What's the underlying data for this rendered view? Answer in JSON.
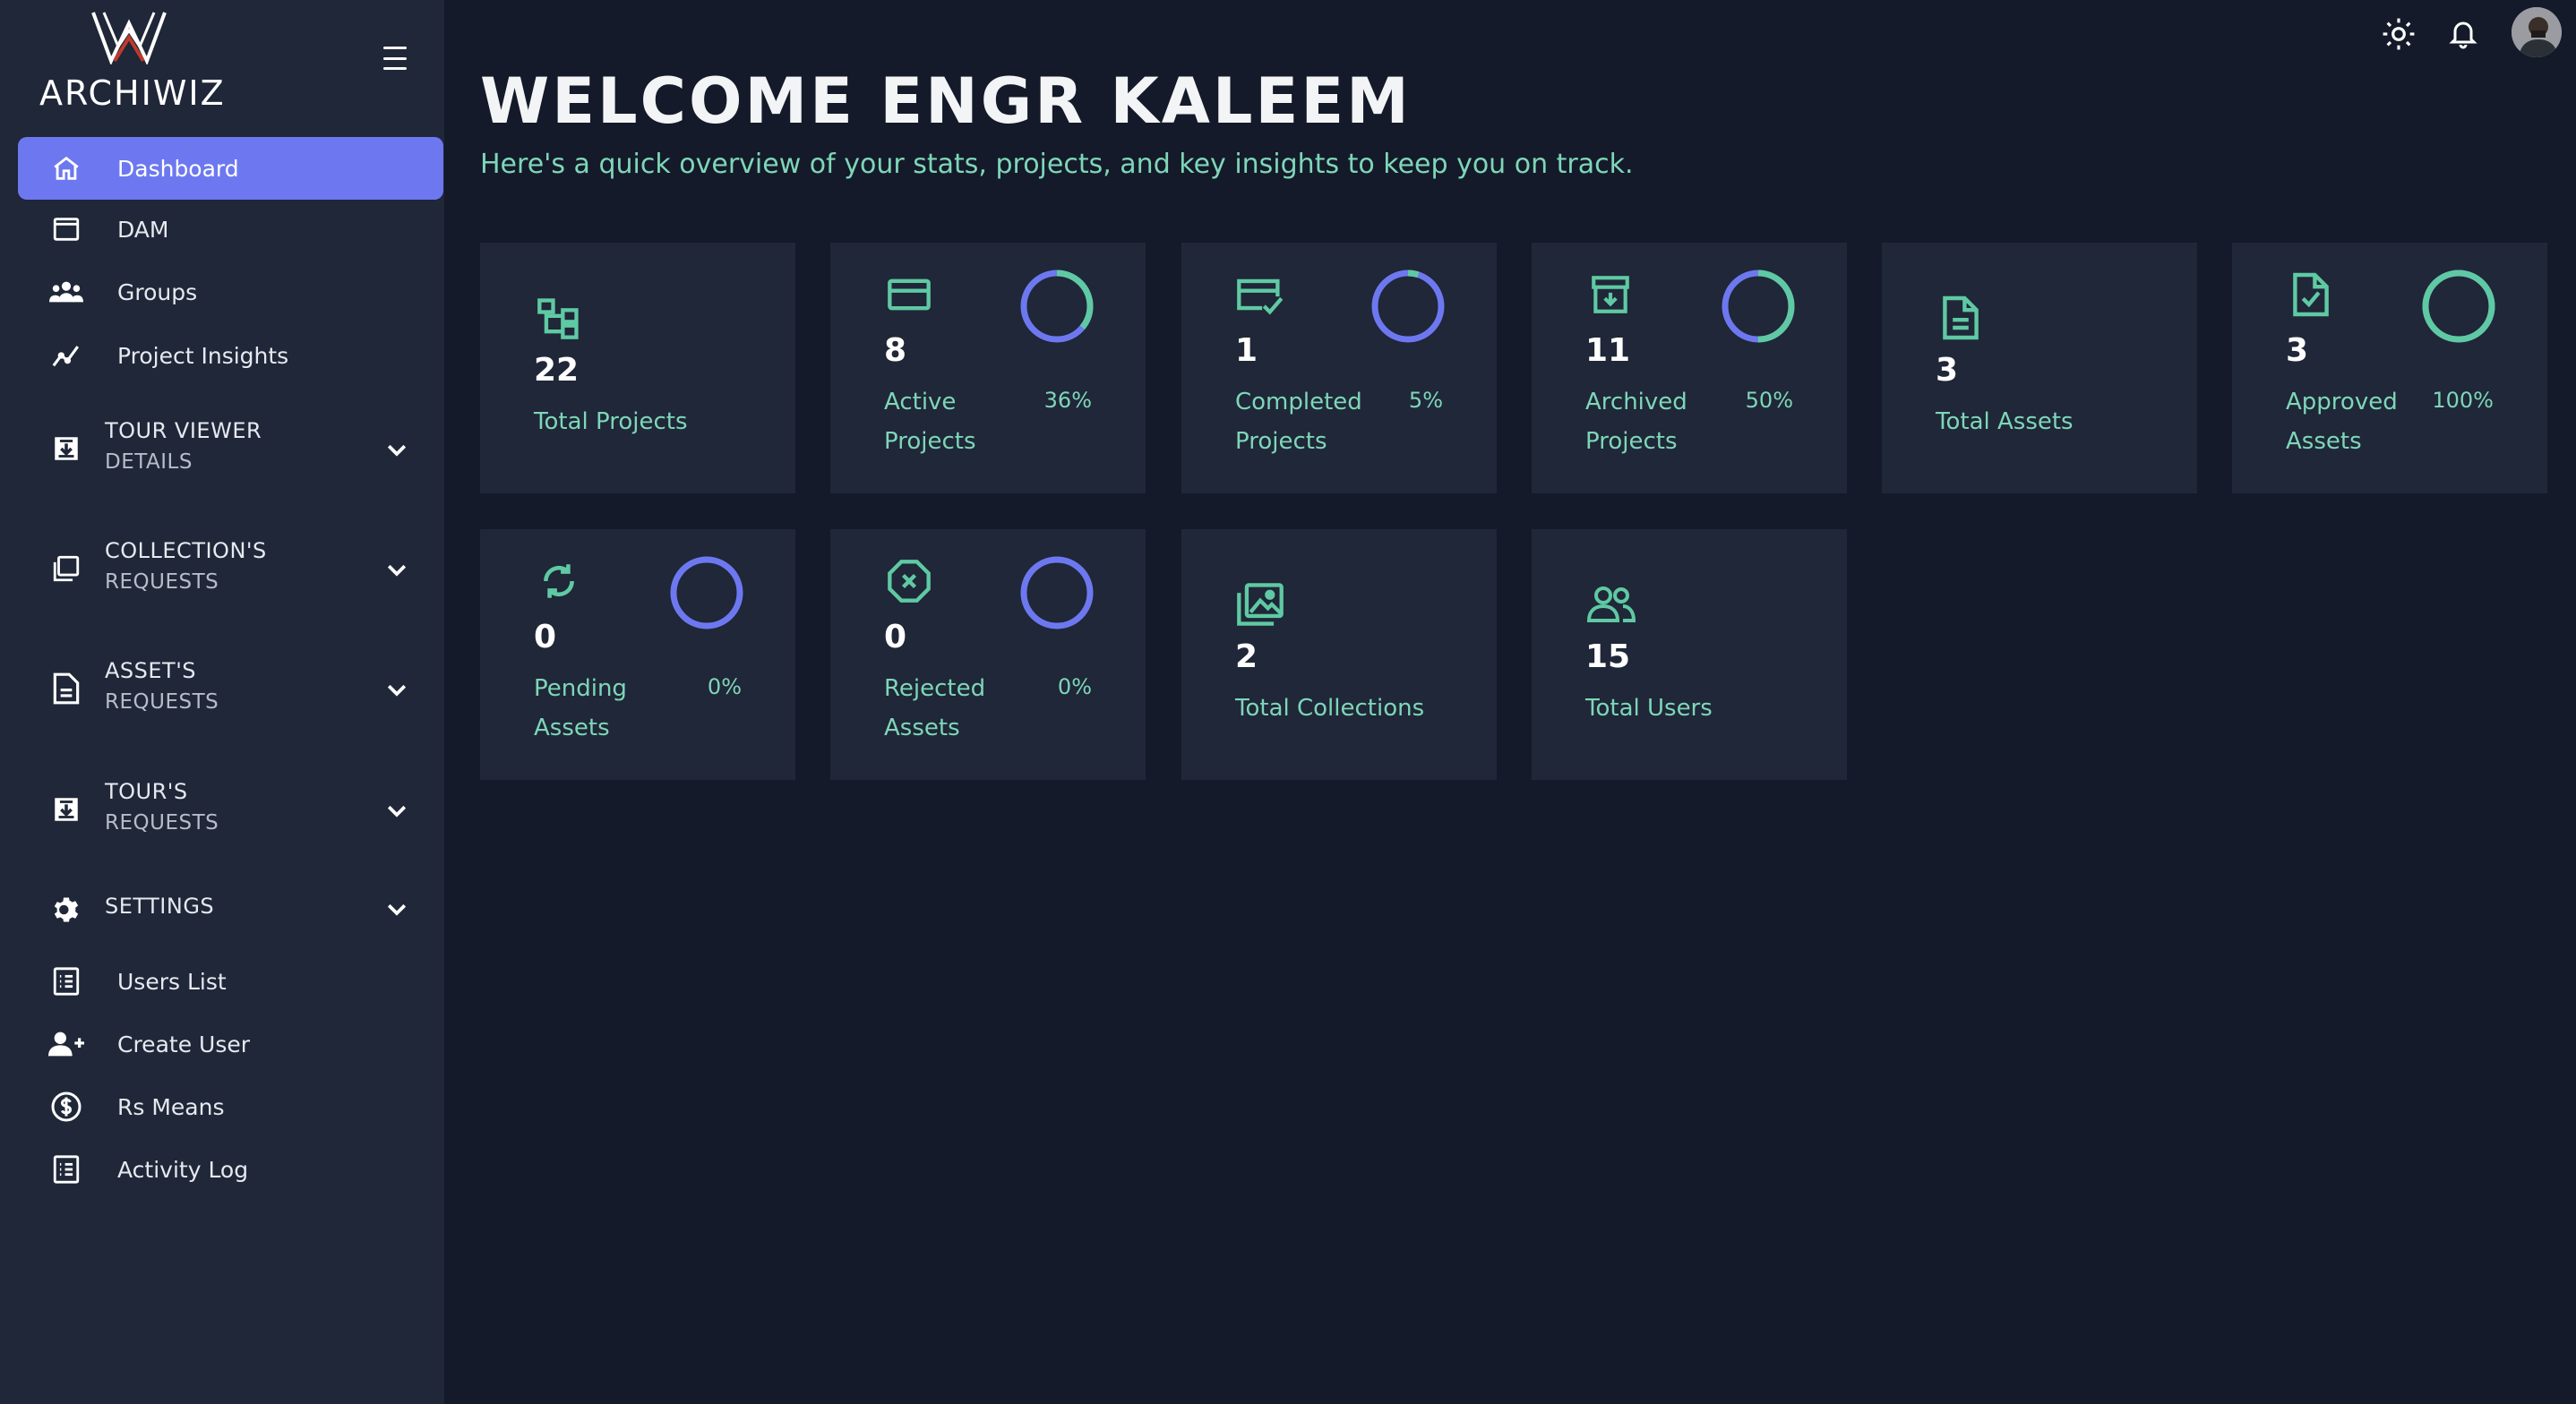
{
  "brand": {
    "name": "ARCHIWIZ"
  },
  "sidebar": {
    "items": [
      {
        "label": "Dashboard",
        "icon": "home-icon",
        "active": true
      },
      {
        "label": "DAM",
        "icon": "window-icon"
      },
      {
        "label": "Groups",
        "icon": "users-group-icon"
      },
      {
        "label": "Project Insights",
        "icon": "chart-line-icon"
      }
    ],
    "groups": [
      {
        "line1": "TOUR VIEWER",
        "line2": "DETAILS",
        "icon": "download-box-icon"
      },
      {
        "line1": "COLLECTION'S",
        "line2": "REQUESTS",
        "icon": "collection-icon"
      },
      {
        "line1": "ASSET'S",
        "line2": "REQUESTS",
        "icon": "document-icon"
      },
      {
        "line1": "TOUR'S",
        "line2": "REQUESTS",
        "icon": "download-box-icon"
      },
      {
        "line1": "SETTINGS",
        "icon": "gear-icon"
      }
    ],
    "settings_items": [
      {
        "label": "Users List",
        "icon": "list-icon"
      },
      {
        "label": "Create User",
        "icon": "user-plus-icon"
      },
      {
        "label": "Rs Means",
        "icon": "dollar-icon"
      },
      {
        "label": "Activity Log",
        "icon": "list-icon"
      }
    ]
  },
  "topbar": {
    "icons": [
      "sun-icon",
      "bell-icon",
      "avatar"
    ]
  },
  "main": {
    "title": "WELCOME ENGR KALEEM",
    "subtitle": "Here's a quick overview of your stats, projects, and key insights to keep you on track."
  },
  "cards": [
    {
      "value": "22",
      "label": "Total Projects",
      "icon": "hierarchy-icon"
    },
    {
      "value": "8",
      "label": "Active Projects",
      "percent": "36%",
      "progress": 0.36,
      "icon": "card-icon"
    },
    {
      "value": "1",
      "label": "Completed Projects",
      "percent": "5%",
      "progress": 0.05,
      "icon": "card-check-icon"
    },
    {
      "value": "11",
      "label": "Archived Projects",
      "percent": "50%",
      "progress": 0.5,
      "icon": "archive-icon"
    },
    {
      "value": "3",
      "label": "Total Assets",
      "icon": "document-icon"
    },
    {
      "value": "3",
      "label": "Approved Assets",
      "percent": "100%",
      "progress": 1.0,
      "icon": "file-check-icon"
    },
    {
      "value": "0",
      "label": "Pending Assets",
      "percent": "0%",
      "progress": 0,
      "icon": "refresh-icon"
    },
    {
      "value": "0",
      "label": "Rejected Assets",
      "percent": "0%",
      "progress": 0,
      "icon": "x-octagon-icon"
    },
    {
      "value": "2",
      "label": "Total Collections",
      "icon": "images-icon"
    },
    {
      "value": "15",
      "label": "Total Users",
      "icon": "users-icon"
    }
  ],
  "colors": {
    "background": "#141a29",
    "panel": "#1f2738",
    "accent": "#6d78f0",
    "green": "#7ed6b8",
    "ring_track": "#6d78f0",
    "ring_fill": "#5fc9a3"
  }
}
